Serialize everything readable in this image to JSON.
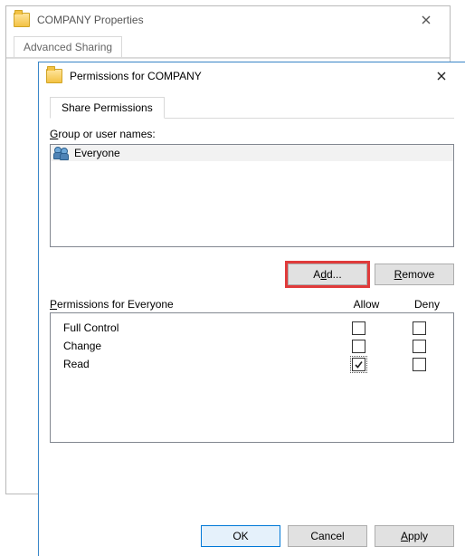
{
  "props_window": {
    "title": "COMPANY Properties",
    "tab_label": "Advanced Sharing"
  },
  "perm_window": {
    "title": "Permissions for COMPANY",
    "tab_label": "Share Permissions",
    "group_label_pre": "G",
    "group_label_post": "roup or user names:",
    "list_item": "Everyone",
    "add_pre": "A",
    "add_post": "dd...",
    "remove_pre": "R",
    "remove_post": "emove",
    "perm_for_pre": "P",
    "perm_for_post": "ermissions for Everyone",
    "col_allow": "Allow",
    "col_deny": "Deny",
    "rows": {
      "full": "Full Control",
      "change": "Change",
      "read": "Read"
    },
    "ok": "OK",
    "cancel": "Cancel",
    "apply_pre": "A",
    "apply_post": "pply"
  }
}
